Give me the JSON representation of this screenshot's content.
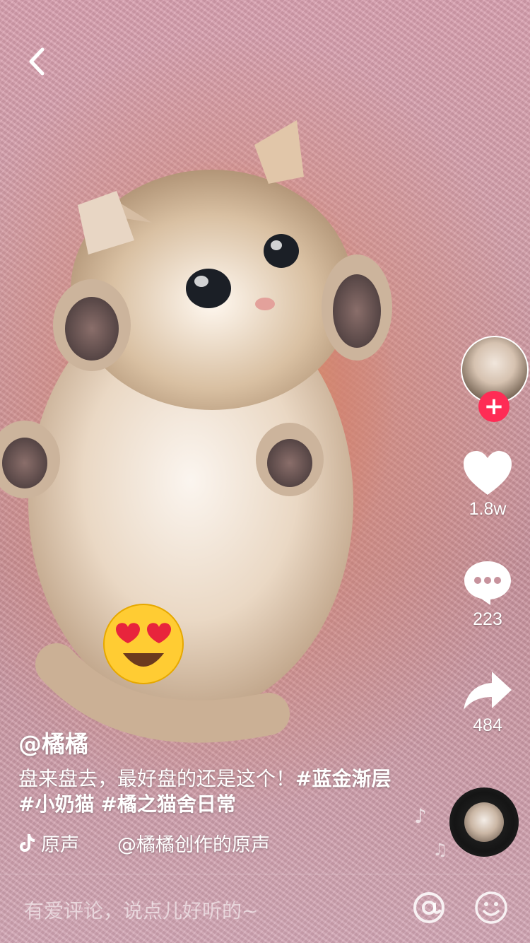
{
  "video": {
    "username": "@橘橘",
    "caption_text": "盘来盘去，最好盘的还是这个！",
    "caption_tags": [
      "#蓝金渐层",
      "#小奶猫",
      "#橘之猫舍日常"
    ],
    "sound_label": "原声",
    "sound_title": "@橘橘创作的原声"
  },
  "actions": {
    "likes": "1.8w",
    "comments": "223",
    "shares": "484"
  },
  "follow": {
    "label": "+"
  },
  "comment_bar": {
    "placeholder": "有爱评论，说点儿好听的~"
  },
  "colors": {
    "accent": "#fe2c55"
  }
}
